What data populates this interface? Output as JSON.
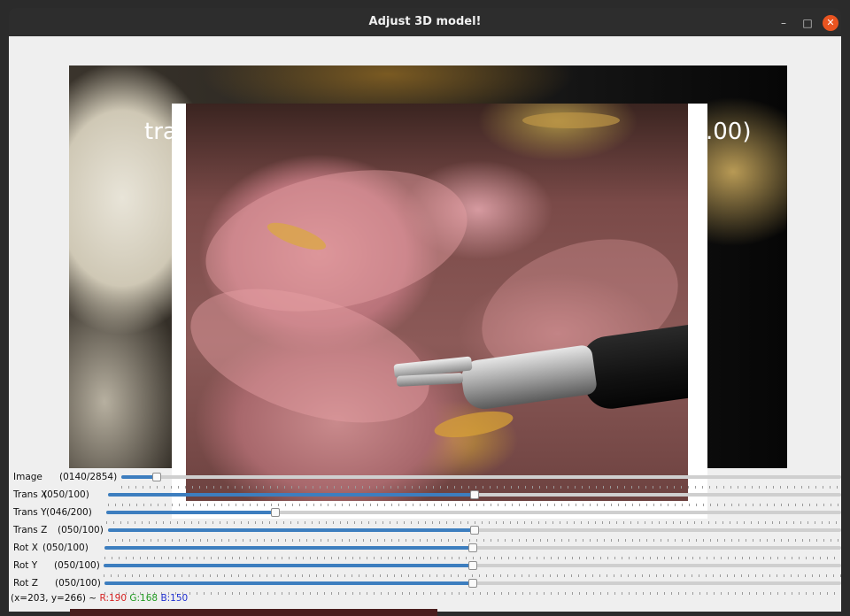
{
  "window": {
    "title": "Adjust 3D model!",
    "minimize_glyph": "–",
    "maximize_glyph": "□",
    "close_glyph": "✕"
  },
  "scene": {
    "text_left": "tra",
    "text_right": ".00)"
  },
  "sliders": [
    {
      "label": "Image",
      "value_text": "(0140/2854)",
      "value": 140,
      "max": 2854
    },
    {
      "label": "Trans X",
      "value_text": "(050/100)",
      "value": 50,
      "max": 100
    },
    {
      "label": "Trans Y",
      "value_text": "(046/200)",
      "value": 46,
      "max": 200
    },
    {
      "label": "Trans Z",
      "value_text": "(050/100)",
      "value": 50,
      "max": 100
    },
    {
      "label": "Rot X",
      "value_text": "(050/100)",
      "value": 50,
      "max": 100
    },
    {
      "label": "Rot Y",
      "value_text": "(050/100)",
      "value": 50,
      "max": 100
    },
    {
      "label": "Rot Z",
      "value_text": "(050/100)",
      "value": 50,
      "max": 100
    }
  ],
  "status": {
    "coords": "(x=203, y=266) ~",
    "r": "R:190",
    "g": "G:168",
    "b": "B:150"
  },
  "colors": {
    "accent": "#3d7ebf",
    "close_button": "#e95420",
    "status_r": "#d62020",
    "status_g": "#1f9a1f",
    "status_b": "#2030d0"
  }
}
